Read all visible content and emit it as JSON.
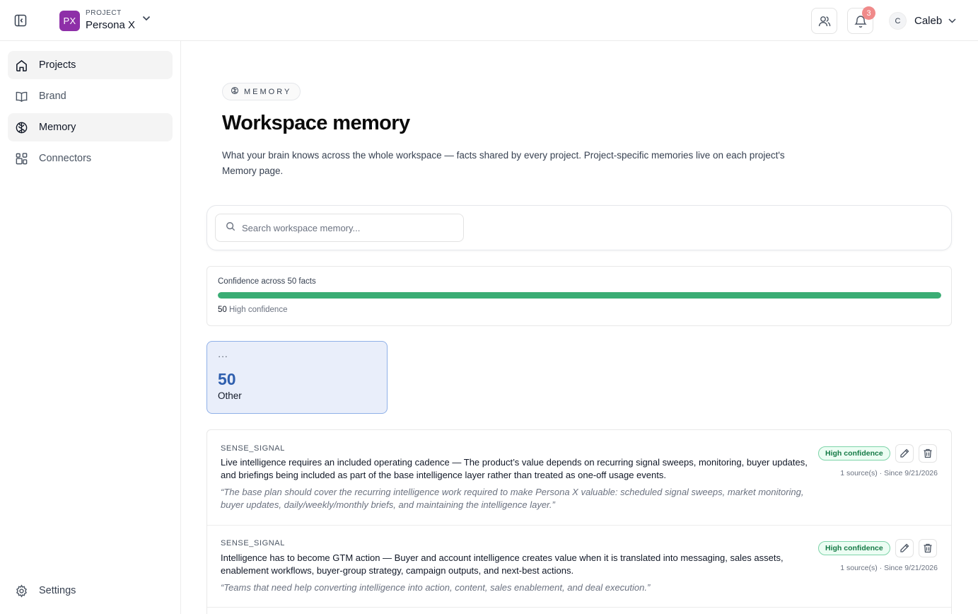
{
  "topbar": {
    "project_caption": "PROJECT",
    "project_initials": "PX",
    "project_name": "Persona X",
    "notification_count": "3",
    "user_initial": "C",
    "user_name": "Caleb"
  },
  "sidebar": {
    "items": [
      {
        "label": "Projects",
        "icon": "home-icon"
      },
      {
        "label": "Brand",
        "icon": "book-icon"
      },
      {
        "label": "Memory",
        "icon": "brain-icon"
      },
      {
        "label": "Connectors",
        "icon": "connectors-icon"
      }
    ],
    "settings_label": "Settings"
  },
  "main": {
    "pill_label": "MEMORY",
    "title": "Workspace memory",
    "description": "What your brain knows across the whole workspace — facts shared by every project. Project-specific memories live on each project's Memory page.",
    "search": {
      "placeholder": "Search workspace memory..."
    },
    "confidence": {
      "title": "Confidence across 50 facts",
      "high_count": "50",
      "high_label": "High confidence",
      "high_fraction": 1.0,
      "bar_color": "#3aad74"
    },
    "category": {
      "icon": "···",
      "count": "50",
      "label": "Other"
    },
    "facts": [
      {
        "type": "SENSE_SIGNAL",
        "body": "Live intelligence requires an included operating cadence — The product’s value depends on recurring signal sweeps, monitoring, buyer updates, and briefings being included as part of the base intelligence layer rather than treated as one-off usage events.",
        "quote": "“The base plan should cover the recurring intelligence work required to make Persona X valuable: scheduled signal sweeps, market monitoring, buyer updates, daily/weekly/monthly briefs, and maintaining the intelligence layer.”",
        "badge": "High confidence",
        "meta": "1 source(s) · Since 9/21/2026"
      },
      {
        "type": "SENSE_SIGNAL",
        "body": "Intelligence has to become GTM action — Buyer and account intelligence creates value when it is translated into messaging, sales assets, enablement workflows, buyer-group strategy, campaign outputs, and next-best actions.",
        "quote": "“Teams that need help converting intelligence into action, content, sales enablement, and deal execution.”",
        "badge": "High confidence",
        "meta": "1 source(s) · Since 9/21/2026"
      }
    ]
  }
}
